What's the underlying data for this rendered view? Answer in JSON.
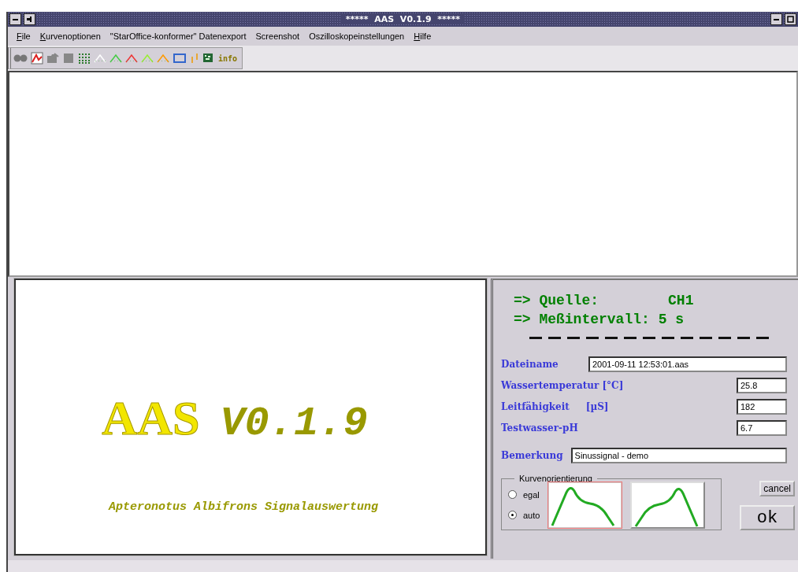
{
  "window": {
    "title": "*****  AAS  V0.1.9  *****"
  },
  "menu": [
    {
      "label": "File",
      "underline_first": true
    },
    {
      "label": "Kurvenoptionen",
      "underline_first": true
    },
    {
      "label": "\"StarOffice-konformer\" Datenexport",
      "underline_first": false
    },
    {
      "label": "Screenshot",
      "underline_first": false
    },
    {
      "label": "Oszilloskopeinstellungen",
      "underline_first": false
    },
    {
      "label": "Hilfe",
      "underline_first": true
    }
  ],
  "toolbar": {
    "info_label": "info"
  },
  "splash": {
    "name": "AAS",
    "version": "V0.1.9",
    "subtitle": "Apteronotus Albifrons Signalauswertung"
  },
  "source": {
    "label": "=> Quelle:",
    "value": "CH1"
  },
  "interval": {
    "label": "=> Meßintervall: 5 s"
  },
  "fields": [
    {
      "label": "Dateiname",
      "value": "2001-09-11 12:53:01.aas",
      "kind": "wide"
    },
    {
      "label": "Wassertemperatur [°C]",
      "value": "25.8",
      "kind": "short"
    },
    {
      "label": "Leitfähigkeit     [µS]",
      "value": "182",
      "kind": "short"
    },
    {
      "label": "Testwasser-pH",
      "value": "6.7",
      "kind": "short"
    }
  ],
  "remark": {
    "label": "Bemerkung",
    "value": "Sinussignal - demo"
  },
  "orientation": {
    "title": "Kurvenorientierung",
    "options": [
      {
        "label": "egal",
        "selected": false
      },
      {
        "label": "auto",
        "selected": true
      }
    ],
    "curves": [
      {
        "kind": "peak-left",
        "selected": true
      },
      {
        "kind": "peak-right",
        "selected": false
      }
    ]
  },
  "buttons": {
    "cancel": "cancel",
    "ok": "ok"
  }
}
